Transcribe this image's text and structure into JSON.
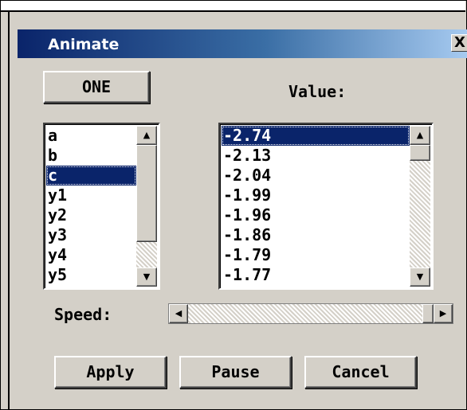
{
  "window": {
    "title": "Animate",
    "close_label": "X"
  },
  "controls": {
    "variable_button_label": "ONE",
    "value_label": "Value:",
    "speed_label": "Speed:"
  },
  "variables": {
    "items": [
      "a",
      "b",
      "c",
      "y1",
      "y2",
      "y3",
      "y4",
      "y5"
    ],
    "selected": "c"
  },
  "values": {
    "items": [
      "-2.74",
      "-2.13",
      "-2.04",
      "-1.99",
      "-1.96",
      "-1.86",
      "-1.79",
      "-1.77"
    ],
    "selected": "-2.74"
  },
  "speed": {
    "level": 1.0
  },
  "actions": {
    "apply_label": "Apply",
    "pause_label": "Pause",
    "cancel_label": "Cancel"
  },
  "colors": {
    "titlebar": "#0a246a",
    "selection": "#0a246a",
    "face": "#d4d0c8"
  },
  "icons": {
    "up": "triangle-up",
    "down": "triangle-down",
    "left": "triangle-left",
    "right": "triangle-right"
  }
}
